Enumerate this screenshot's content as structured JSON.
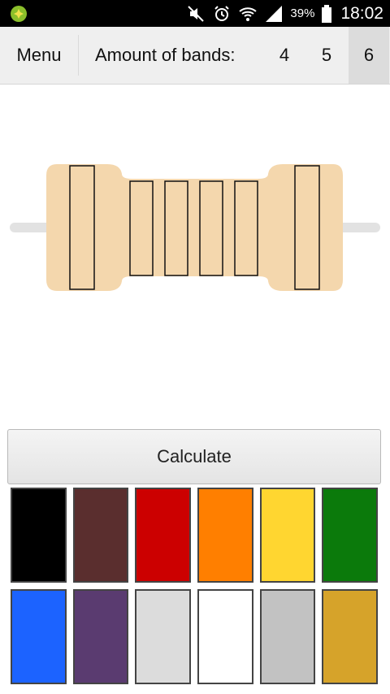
{
  "status_bar": {
    "battery_text": "39%",
    "time": "18:02",
    "icons": [
      "app-notification-icon",
      "mute-icon",
      "alarm-icon",
      "wifi-icon",
      "signal-icon",
      "battery-icon"
    ]
  },
  "topbar": {
    "menu_label": "Menu",
    "bands_label": "Amount of bands:",
    "band_options": [
      "4",
      "5",
      "6"
    ],
    "selected_band": "6"
  },
  "resistor": {
    "band_count": 6,
    "body_color": "#f4d7ad",
    "lead_color": "#e2e2e2",
    "band_colors": [
      "none",
      "none",
      "none",
      "none",
      "none",
      "none"
    ]
  },
  "calculate_label": "Calculate",
  "palette": {
    "colors": [
      {
        "name": "black",
        "hex": "#000000"
      },
      {
        "name": "brown",
        "hex": "#5a2e2e"
      },
      {
        "name": "red",
        "hex": "#cc0000"
      },
      {
        "name": "orange",
        "hex": "#ff7f00"
      },
      {
        "name": "yellow",
        "hex": "#ffd630"
      },
      {
        "name": "green",
        "hex": "#0b7a0b"
      },
      {
        "name": "blue",
        "hex": "#1c63ff"
      },
      {
        "name": "violet",
        "hex": "#5a3b70"
      },
      {
        "name": "grey",
        "hex": "#dcdcdc"
      },
      {
        "name": "white",
        "hex": "#ffffff"
      },
      {
        "name": "silver",
        "hex": "#c2c2c2"
      },
      {
        "name": "gold",
        "hex": "#d6a32a"
      }
    ]
  }
}
